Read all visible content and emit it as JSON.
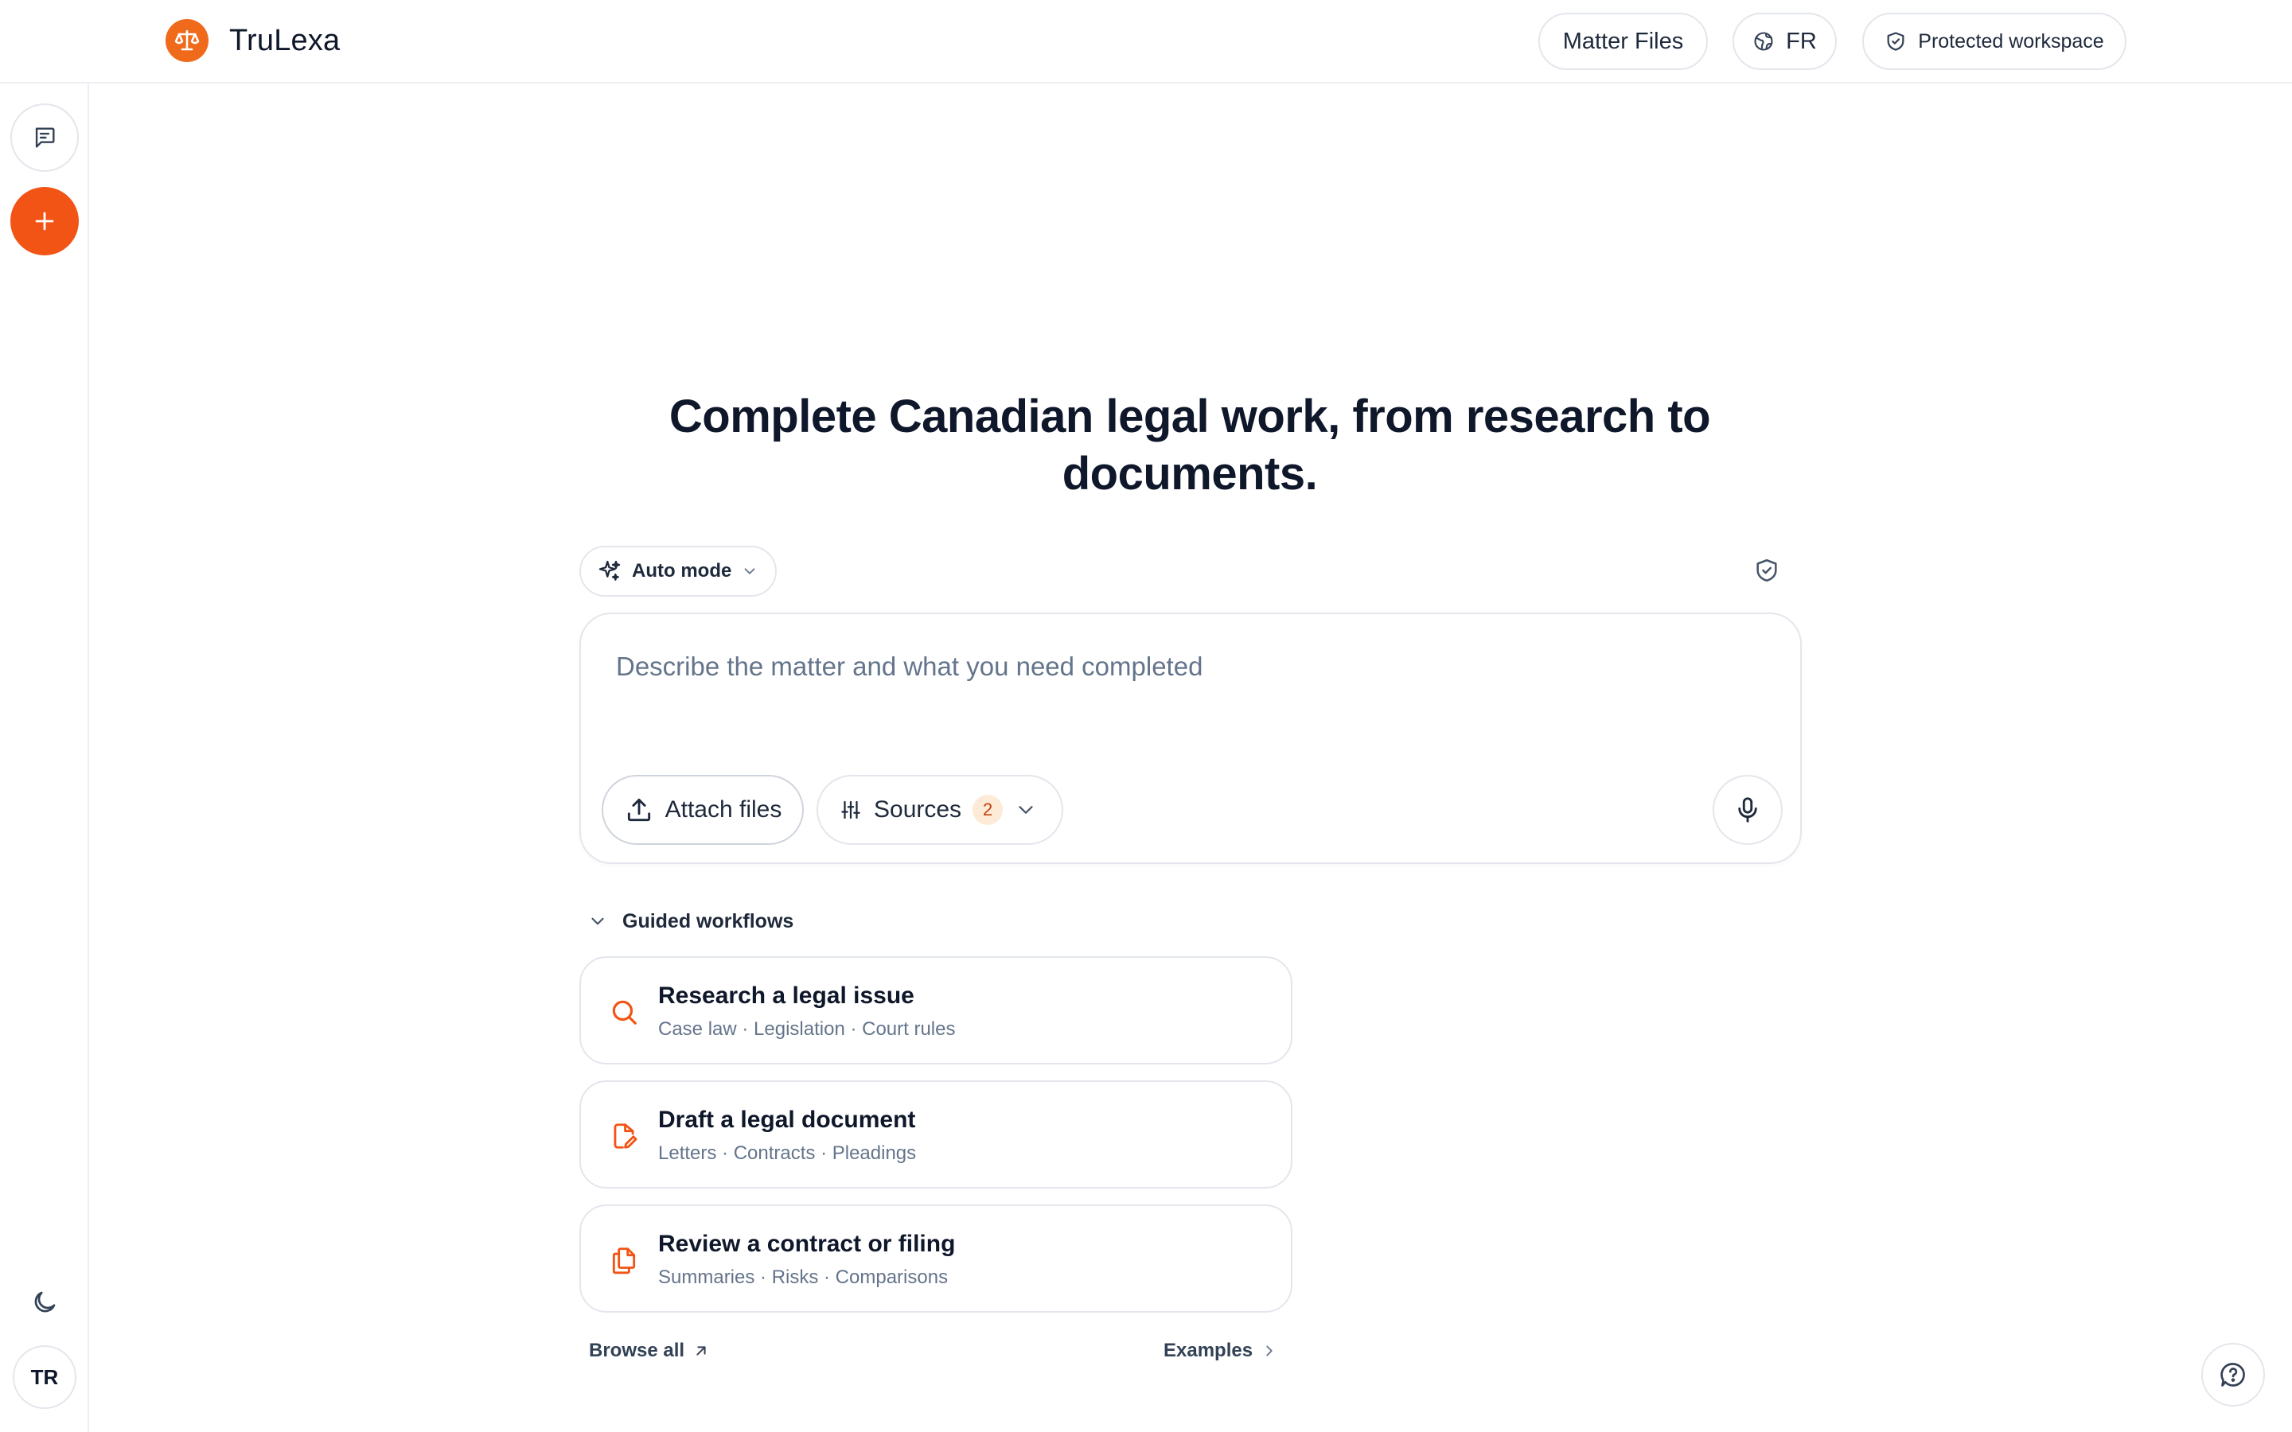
{
  "app": {
    "name": "TruLexa"
  },
  "header": {
    "matter_files": "Matter Files",
    "language": "FR",
    "workspace_status": "Protected workspace"
  },
  "rail": {
    "avatar_initials": "TR"
  },
  "hero": {
    "title": "Complete Canadian legal work, from research to documents."
  },
  "mode": {
    "label": "Auto mode"
  },
  "composer": {
    "placeholder": "Describe the matter and what you need completed",
    "value": "",
    "attach_label": "Attach files",
    "sources_label": "Sources",
    "sources_count": "2"
  },
  "workflows": {
    "heading": "Guided workflows",
    "items": [
      {
        "title": "Research a legal issue",
        "subtitle": "Case law · Legislation · Court rules",
        "icon": "search-icon"
      },
      {
        "title": "Draft a legal document",
        "subtitle": "Letters · Contracts · Pleadings",
        "icon": "document-edit-icon"
      },
      {
        "title": "Review a contract or filing",
        "subtitle": "Summaries · Risks · Comparisons",
        "icon": "copy-documents-icon"
      }
    ],
    "browse_all": "Browse all",
    "examples": "Examples"
  },
  "colors": {
    "accent": "#f25415",
    "logo": "#ef6a1b",
    "text": "#0f172a",
    "muted": "#64748b",
    "border": "#e3e6ec"
  }
}
